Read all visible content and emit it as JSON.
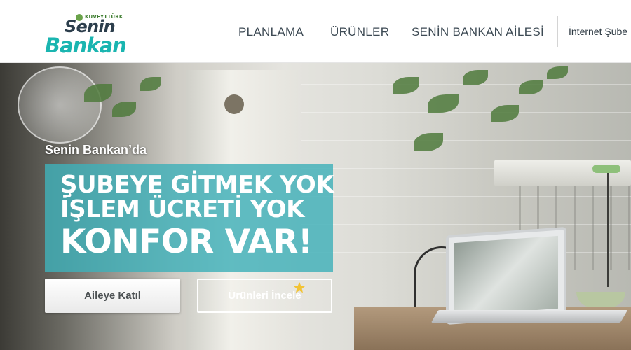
{
  "header": {
    "logo": {
      "small_text": "KUVEYTTÜRK",
      "top_text": "Senin",
      "bottom_text": "Bankan"
    },
    "nav": [
      {
        "label": "PLANLAMA"
      },
      {
        "label": "ÜRÜNLER"
      },
      {
        "label": "SENİN BANKAN AİLESİ"
      }
    ],
    "internet_branch": "İnternet Şube"
  },
  "hero": {
    "intro": "Senin Bankan’da",
    "headline": [
      "ŞUBEYE GİTMEK YOK",
      "İŞLEM ÜCRETİ YOK",
      "KONFOR VAR!"
    ],
    "buttons": {
      "join": "Aileye Katıl",
      "products": "Ürünleri İncele"
    }
  },
  "colors": {
    "brand_teal": "#1ab5b0",
    "overlay_teal": "#3fb0b8",
    "logo_dark": "#2c3e4c",
    "star": "#f2c335"
  },
  "icons": {
    "logo_badge": "leaf-badge-icon",
    "products_button_decoration": "star-icon"
  }
}
